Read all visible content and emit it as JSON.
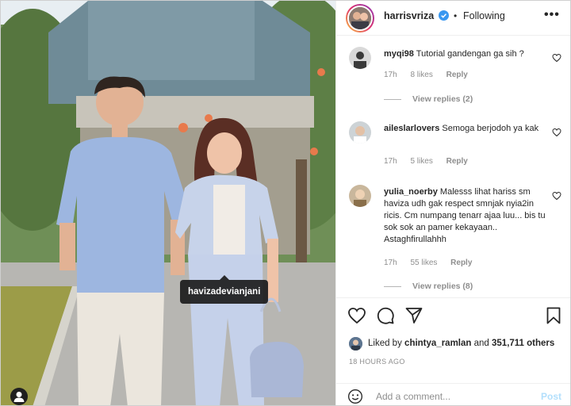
{
  "post": {
    "tagged_user": "havizadevianjani"
  },
  "header": {
    "username": "harrisvriza",
    "separator": "•",
    "follow_label": "Following",
    "more_label": "•••"
  },
  "comments": [
    {
      "username": "myqi98",
      "text": "Tutorial gandengan ga sih ?",
      "time": "17h",
      "likes": "8 likes",
      "reply_label": "Reply",
      "view_replies": "View replies (2)"
    },
    {
      "username": "aileslarlovers",
      "text": "Semoga berjodoh ya kak",
      "time": "17h",
      "likes": "5 likes",
      "reply_label": "Reply"
    },
    {
      "username": "yulia_noerby",
      "text": "Malesss lihat hariss sm haviza udh gak respect smnjak nyia2in ricis. Cm numpang tenarr ajaa luu... bis tu sok sok an pamer kekayaan.. Astaghfirullahhh",
      "time": "17h",
      "likes": "55 likes",
      "reply_label": "Reply",
      "view_replies": "View replies (8)"
    }
  ],
  "likes": {
    "prefix": "Liked by",
    "user": "chintya_ramlan",
    "middle": "and",
    "count": "351,711 others"
  },
  "timestamp": "18 HOURS AGO",
  "add_comment": {
    "placeholder": "Add a comment...",
    "post_label": "Post"
  },
  "colors": {
    "verified": "#3897f0",
    "post_disabled": "#b2dffc",
    "secondary_text": "#8e8e8e"
  },
  "icons": [
    "heart-icon",
    "comment-icon",
    "share-icon",
    "bookmark-icon",
    "emoji-icon",
    "verified-badge-icon",
    "user-tag-icon",
    "more-options-icon"
  ]
}
